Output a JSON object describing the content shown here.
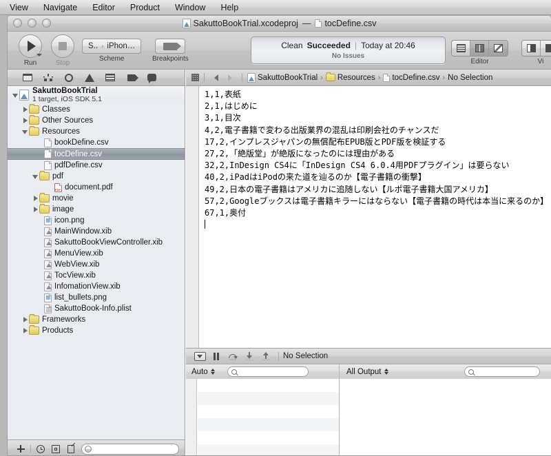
{
  "menubar": {
    "items": [
      "View",
      "Navigate",
      "Editor",
      "Product",
      "Window",
      "Help"
    ]
  },
  "window": {
    "title_project": "SakuttoBookTrial.xcodeproj",
    "title_dash": "—",
    "title_file": "tocDefine.csv"
  },
  "toolbar": {
    "run_label": "Run",
    "stop_label": "Stop",
    "scheme_label": "Scheme",
    "scheme_target": "S..",
    "scheme_sep": "›",
    "scheme_device": "iPhon…",
    "breakpoints_label": "Breakpoints",
    "editor_label": "Editor",
    "view_label": "Vi",
    "status": {
      "action": "Clean",
      "result": "Succeeded",
      "divider": "|",
      "time": "Today at 20:46",
      "issues": "No Issues"
    }
  },
  "navigator": {
    "tree": [
      {
        "indent": 0,
        "disclosure": "open",
        "icon": "project-icon",
        "label": "SakuttoBookTrial",
        "sublabel": "1 target, iOS SDK 5.1",
        "type": "project",
        "selected": false
      },
      {
        "indent": 1,
        "disclosure": "closed",
        "icon": "folder-icon",
        "label": "Classes",
        "type": "folder",
        "selected": false
      },
      {
        "indent": 1,
        "disclosure": "closed",
        "icon": "folder-icon",
        "label": "Other Sources",
        "type": "folder",
        "selected": false
      },
      {
        "indent": 1,
        "disclosure": "open",
        "icon": "folder-icon",
        "label": "Resources",
        "type": "folder",
        "selected": false
      },
      {
        "indent": 2,
        "disclosure": "none",
        "icon": "csv-file-icon",
        "label": "bookDefine.csv",
        "type": "doc",
        "selected": false
      },
      {
        "indent": 2,
        "disclosure": "none",
        "icon": "csv-file-icon",
        "label": "tocDefine.csv",
        "type": "doc",
        "selected": true
      },
      {
        "indent": 2,
        "disclosure": "none",
        "icon": "csv-file-icon",
        "label": "pdfDefine.csv",
        "type": "doc",
        "selected": false
      },
      {
        "indent": 2,
        "disclosure": "open",
        "icon": "folder-icon",
        "label": "pdf",
        "type": "folder",
        "selected": false
      },
      {
        "indent": 3,
        "disclosure": "none",
        "icon": "pdf-file-icon",
        "label": "document.pdf",
        "type": "pdf",
        "selected": false
      },
      {
        "indent": 2,
        "disclosure": "closed",
        "icon": "folder-icon",
        "label": "movie",
        "type": "folder",
        "selected": false
      },
      {
        "indent": 2,
        "disclosure": "closed",
        "icon": "folder-icon",
        "label": "image",
        "type": "folder",
        "selected": false
      },
      {
        "indent": 2,
        "disclosure": "none",
        "icon": "png-file-icon",
        "label": "icon.png",
        "type": "png",
        "selected": false
      },
      {
        "indent": 2,
        "disclosure": "none",
        "icon": "xib-file-icon",
        "label": "MainWindow.xib",
        "type": "xib",
        "selected": false
      },
      {
        "indent": 2,
        "disclosure": "none",
        "icon": "xib-file-icon",
        "label": "SakuttoBookViewController.xib",
        "type": "xib",
        "selected": false
      },
      {
        "indent": 2,
        "disclosure": "none",
        "icon": "xib-file-icon",
        "label": "MenuView.xib",
        "type": "xib",
        "selected": false
      },
      {
        "indent": 2,
        "disclosure": "none",
        "icon": "xib-file-icon",
        "label": "WebView.xib",
        "type": "xib",
        "selected": false
      },
      {
        "indent": 2,
        "disclosure": "none",
        "icon": "xib-file-icon",
        "label": "TocView.xib",
        "type": "xib",
        "selected": false
      },
      {
        "indent": 2,
        "disclosure": "none",
        "icon": "xib-file-icon",
        "label": "InfomationView.xib",
        "type": "xib",
        "selected": false
      },
      {
        "indent": 2,
        "disclosure": "none",
        "icon": "png-file-icon",
        "label": "list_bullets.png",
        "type": "png",
        "selected": false
      },
      {
        "indent": 2,
        "disclosure": "none",
        "icon": "plist-file-icon",
        "label": "SakuttoBook-Info.plist",
        "type": "plist",
        "selected": false
      },
      {
        "indent": 1,
        "disclosure": "closed",
        "icon": "folder-icon",
        "label": "Frameworks",
        "type": "folder",
        "selected": false
      },
      {
        "indent": 1,
        "disclosure": "closed",
        "icon": "folder-icon",
        "label": "Products",
        "type": "folder",
        "selected": false
      }
    ],
    "toolbar_icons": [
      "project-navigator-icon",
      "symbol-navigator-icon",
      "search-navigator-icon",
      "issue-navigator-icon",
      "test-navigator-icon",
      "breakpoint-navigator-icon",
      "log-navigator-icon"
    ],
    "footer_icons": [
      "add-icon",
      "recent-icon",
      "source-control-icon",
      "unsaved-icon"
    ],
    "filter_placeholder": ""
  },
  "breadcrumb": {
    "items": [
      "SakuttoBookTrial",
      "Resources",
      "tocDefine.csv",
      "No Selection"
    ],
    "separator": "›"
  },
  "editor": {
    "lines": [
      "1,1,表紙",
      "2,1,はじめに",
      "3,1,目次",
      "4,2,電子書籍で変わる出版業界の混乱は印刷会社のチャンスだ",
      "17,2,インプレスジャパンの無償配布EPUB版とPDF版を検証する",
      "27,2,「絶版堂」が絶版になったのには理由がある",
      "32,2,InDesign CS4に「InDesign CS4 6.0.4用PDFプラグイン」は要らない",
      "40,2,iPadはiPodの来た道を辿るのか【電子書籍の衝撃】",
      "49,2,日本の電子書籍はアメリカに追随しない【ルポ電子書籍大国アメリカ】",
      "57,2,Googleブックスは電子書籍キラーにはならない【電子書籍の時代は本当に来るのか】",
      "67,1,奥付"
    ]
  },
  "debug": {
    "bar_label": "No Selection",
    "bar_icons": [
      "toggle-console-icon",
      "pause-icon",
      "step-over-icon",
      "step-into-icon",
      "step-out-icon"
    ],
    "scope_popup": "Auto",
    "variables_search_placeholder": "",
    "output_popup": "All Output"
  },
  "colors": {
    "selection": "#949ca8",
    "status_panel": "#eef1f4",
    "navigator_bg": "#e9ecf0",
    "folder": "#ecd878"
  }
}
